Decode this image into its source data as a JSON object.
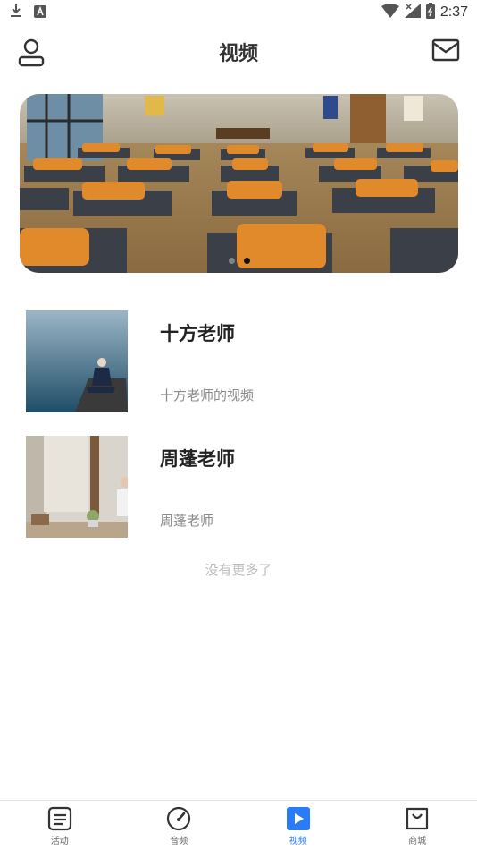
{
  "status_bar": {
    "time": "2:37"
  },
  "header": {
    "title": "视频"
  },
  "banner": {
    "dot_count": 2,
    "active_dot": 1
  },
  "teachers": [
    {
      "name": "十方老师",
      "desc": "十方老师的视频"
    },
    {
      "name": "周蓬老师",
      "desc": "周蓬老师"
    }
  ],
  "list_footer": "没有更多了",
  "bottom_nav": [
    {
      "label": "活动",
      "icon": "activity-list-icon",
      "active": false
    },
    {
      "label": "音频",
      "icon": "audio-gauge-icon",
      "active": false
    },
    {
      "label": "视频",
      "icon": "video-play-icon",
      "active": true
    },
    {
      "label": "商城",
      "icon": "shop-bag-icon",
      "active": false
    }
  ],
  "colors": {
    "accent": "#2a7cf6",
    "muted_text": "#8a8a8a",
    "footer_text": "#bbbbbb"
  }
}
